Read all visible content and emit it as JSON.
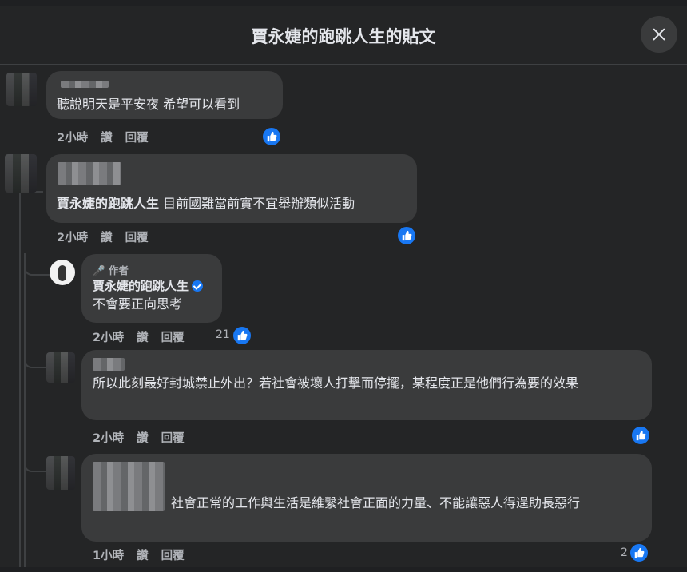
{
  "modal": {
    "title": "賈永婕的跑跳人生的貼文"
  },
  "actions": {
    "like": "讚",
    "reply": "回覆"
  },
  "comments": [
    {
      "text": "聽說明天是平安夜 希望可以看到",
      "time": "2小時"
    },
    {
      "mention": "賈永婕的跑跳人生",
      "text": " 目前國難當前實不宜舉辦類似活動",
      "time": "2小時"
    },
    {
      "author_tag": "作者",
      "name": "賈永婕的跑跳人生",
      "text": "不會要正向思考",
      "time": "2小時",
      "likes": "21"
    },
    {
      "text": "所以此刻最好封城禁止外出？若社會被壞人打擊而停擺，某程度正是他們行為要的效果",
      "time": "2小時"
    },
    {
      "text": "社會正常的工作與生活是維繫社會正面的力量、不能讓惡人得逞助長惡行",
      "time": "1小時",
      "likes": "2"
    }
  ]
}
